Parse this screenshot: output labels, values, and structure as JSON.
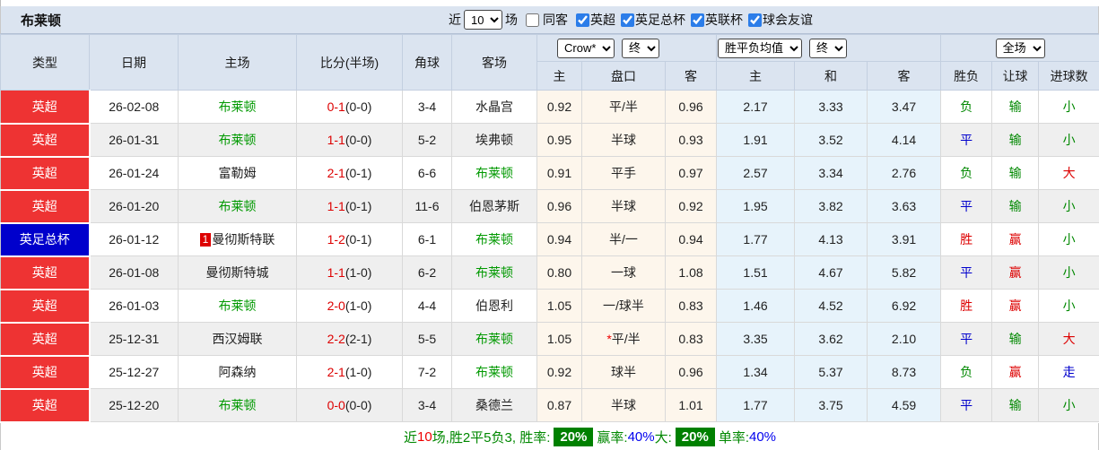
{
  "toolbar": {
    "title": "布莱顿",
    "recent_label": "近",
    "matches_value": "10",
    "matches_unit": "场",
    "same_opponent_label": "同客",
    "league_filters": [
      "英超",
      "英足总杯",
      "英联杯",
      "球会友谊"
    ]
  },
  "header": {
    "left_columns": [
      "类型",
      "日期",
      "主场",
      "比分(半场)",
      "角球",
      "客场"
    ],
    "groups": [
      {
        "selects": [
          "Crow*",
          "终"
        ],
        "sub": [
          "主",
          "盘口",
          "客"
        ]
      },
      {
        "selects": [
          "胜平负均值",
          "终"
        ],
        "sub": [
          "主",
          "和",
          "客"
        ]
      },
      {
        "selects": [
          "全场"
        ],
        "sub": [
          "胜负",
          "让球",
          "进球数"
        ]
      }
    ]
  },
  "rows": [
    {
      "league": "英超",
      "league_color": "red",
      "date": "26-02-08",
      "home": "布莱顿",
      "home_green": true,
      "home_badge": "",
      "score": "0-1",
      "half": "(0-0)",
      "corners": "3-4",
      "away": "水晶宫",
      "away_green": false,
      "asian": [
        "0.92",
        "平/半",
        "0.96"
      ],
      "asian_star": false,
      "europe": [
        "2.17",
        "3.33",
        "3.47"
      ],
      "result": "负",
      "result_color": "green",
      "handicap": "输",
      "handicap_color": "green",
      "goals": "小",
      "goals_color": "green"
    },
    {
      "league": "英超",
      "league_color": "red",
      "date": "26-01-31",
      "home": "布莱顿",
      "home_green": true,
      "home_badge": "",
      "score": "1-1",
      "half": "(0-0)",
      "corners": "5-2",
      "away": "埃弗顿",
      "away_green": false,
      "asian": [
        "0.95",
        "半球",
        "0.93"
      ],
      "asian_star": false,
      "europe": [
        "1.91",
        "3.52",
        "4.14"
      ],
      "result": "平",
      "result_color": "blue",
      "handicap": "输",
      "handicap_color": "green",
      "goals": "小",
      "goals_color": "green"
    },
    {
      "league": "英超",
      "league_color": "red",
      "date": "26-01-24",
      "home": "富勒姆",
      "home_green": false,
      "home_badge": "",
      "score": "2-1",
      "half": "(0-1)",
      "corners": "6-6",
      "away": "布莱顿",
      "away_green": true,
      "asian": [
        "0.91",
        "平手",
        "0.97"
      ],
      "asian_star": false,
      "europe": [
        "2.57",
        "3.34",
        "2.76"
      ],
      "result": "负",
      "result_color": "green",
      "handicap": "输",
      "handicap_color": "green",
      "goals": "大",
      "goals_color": "red"
    },
    {
      "league": "英超",
      "league_color": "red",
      "date": "26-01-20",
      "home": "布莱顿",
      "home_green": true,
      "home_badge": "",
      "score": "1-1",
      "half": "(0-1)",
      "corners": "11-6",
      "away": "伯恩茅斯",
      "away_green": false,
      "asian": [
        "0.96",
        "半球",
        "0.92"
      ],
      "asian_star": false,
      "europe": [
        "1.95",
        "3.82",
        "3.63"
      ],
      "result": "平",
      "result_color": "blue",
      "handicap": "输",
      "handicap_color": "green",
      "goals": "小",
      "goals_color": "green"
    },
    {
      "league": "英足总杯",
      "league_color": "blue",
      "date": "26-01-12",
      "home": "曼彻斯特联",
      "home_green": false,
      "home_badge": "1",
      "score": "1-2",
      "half": "(0-1)",
      "corners": "6-1",
      "away": "布莱顿",
      "away_green": true,
      "asian": [
        "0.94",
        "半/一",
        "0.94"
      ],
      "asian_star": false,
      "europe": [
        "1.77",
        "4.13",
        "3.91"
      ],
      "result": "胜",
      "result_color": "red",
      "handicap": "赢",
      "handicap_color": "red",
      "goals": "小",
      "goals_color": "green"
    },
    {
      "league": "英超",
      "league_color": "red",
      "date": "26-01-08",
      "home": "曼彻斯特城",
      "home_green": false,
      "home_badge": "",
      "score": "1-1",
      "half": "(1-0)",
      "corners": "6-2",
      "away": "布莱顿",
      "away_green": true,
      "asian": [
        "0.80",
        "一球",
        "1.08"
      ],
      "asian_star": false,
      "europe": [
        "1.51",
        "4.67",
        "5.82"
      ],
      "result": "平",
      "result_color": "blue",
      "handicap": "赢",
      "handicap_color": "red",
      "goals": "小",
      "goals_color": "green"
    },
    {
      "league": "英超",
      "league_color": "red",
      "date": "26-01-03",
      "home": "布莱顿",
      "home_green": true,
      "home_badge": "",
      "score": "2-0",
      "half": "(1-0)",
      "corners": "4-4",
      "away": "伯恩利",
      "away_green": false,
      "asian": [
        "1.05",
        "一/球半",
        "0.83"
      ],
      "asian_star": false,
      "europe": [
        "1.46",
        "4.52",
        "6.92"
      ],
      "result": "胜",
      "result_color": "red",
      "handicap": "赢",
      "handicap_color": "red",
      "goals": "小",
      "goals_color": "green"
    },
    {
      "league": "英超",
      "league_color": "red",
      "date": "25-12-31",
      "home": "西汉姆联",
      "home_green": false,
      "home_badge": "",
      "score": "2-2",
      "half": "(2-1)",
      "corners": "5-5",
      "away": "布莱顿",
      "away_green": true,
      "asian": [
        "1.05",
        "平/半",
        "0.83"
      ],
      "asian_star": true,
      "europe": [
        "3.35",
        "3.62",
        "2.10"
      ],
      "result": "平",
      "result_color": "blue",
      "handicap": "输",
      "handicap_color": "green",
      "goals": "大",
      "goals_color": "red"
    },
    {
      "league": "英超",
      "league_color": "red",
      "date": "25-12-27",
      "home": "阿森纳",
      "home_green": false,
      "home_badge": "",
      "score": "2-1",
      "half": "(1-0)",
      "corners": "7-2",
      "away": "布莱顿",
      "away_green": true,
      "asian": [
        "0.92",
        "球半",
        "0.96"
      ],
      "asian_star": false,
      "europe": [
        "1.34",
        "5.37",
        "8.73"
      ],
      "result": "负",
      "result_color": "green",
      "handicap": "赢",
      "handicap_color": "red",
      "goals": "走",
      "goals_color": "blue"
    },
    {
      "league": "英超",
      "league_color": "red",
      "date": "25-12-20",
      "home": "布莱顿",
      "home_green": true,
      "home_badge": "",
      "score": "0-0",
      "half": "(0-0)",
      "corners": "3-4",
      "away": "桑德兰",
      "away_green": false,
      "asian": [
        "0.87",
        "半球",
        "1.01"
      ],
      "asian_star": false,
      "europe": [
        "1.77",
        "3.75",
        "4.59"
      ],
      "result": "平",
      "result_color": "blue",
      "handicap": "输",
      "handicap_color": "green",
      "goals": "小",
      "goals_color": "green"
    }
  ],
  "footer": {
    "segments": [
      {
        "text": "近",
        "style": "green"
      },
      {
        "text": "10",
        "style": "red"
      },
      {
        "text": "场,胜2平5负3, 胜率:",
        "style": "green"
      },
      {
        "text": "20%",
        "style": "badge"
      },
      {
        "text": " 赢率:",
        "style": "green"
      },
      {
        "text": "40%",
        "style": "blue"
      },
      {
        "text": " 大:",
        "style": "green"
      },
      {
        "text": "20%",
        "style": "badge"
      },
      {
        "text": " 单率:",
        "style": "green"
      },
      {
        "text": "40%",
        "style": "blue"
      }
    ]
  },
  "colors": {
    "league_red": "#ee3333",
    "league_blue": "#0000cc",
    "team_highlight_green": "#009900",
    "score_red": "#dd0000",
    "win_red": "#dd0000",
    "draw_blue": "#0000cc",
    "lose_green": "#008800",
    "pct_badge_bg": "#008000",
    "pct_blue": "#0000ee",
    "header_bg": "#dbe4f0",
    "asian_col_bg": "#fdf6ec",
    "euro_col_bg": "#e7f3fb"
  }
}
